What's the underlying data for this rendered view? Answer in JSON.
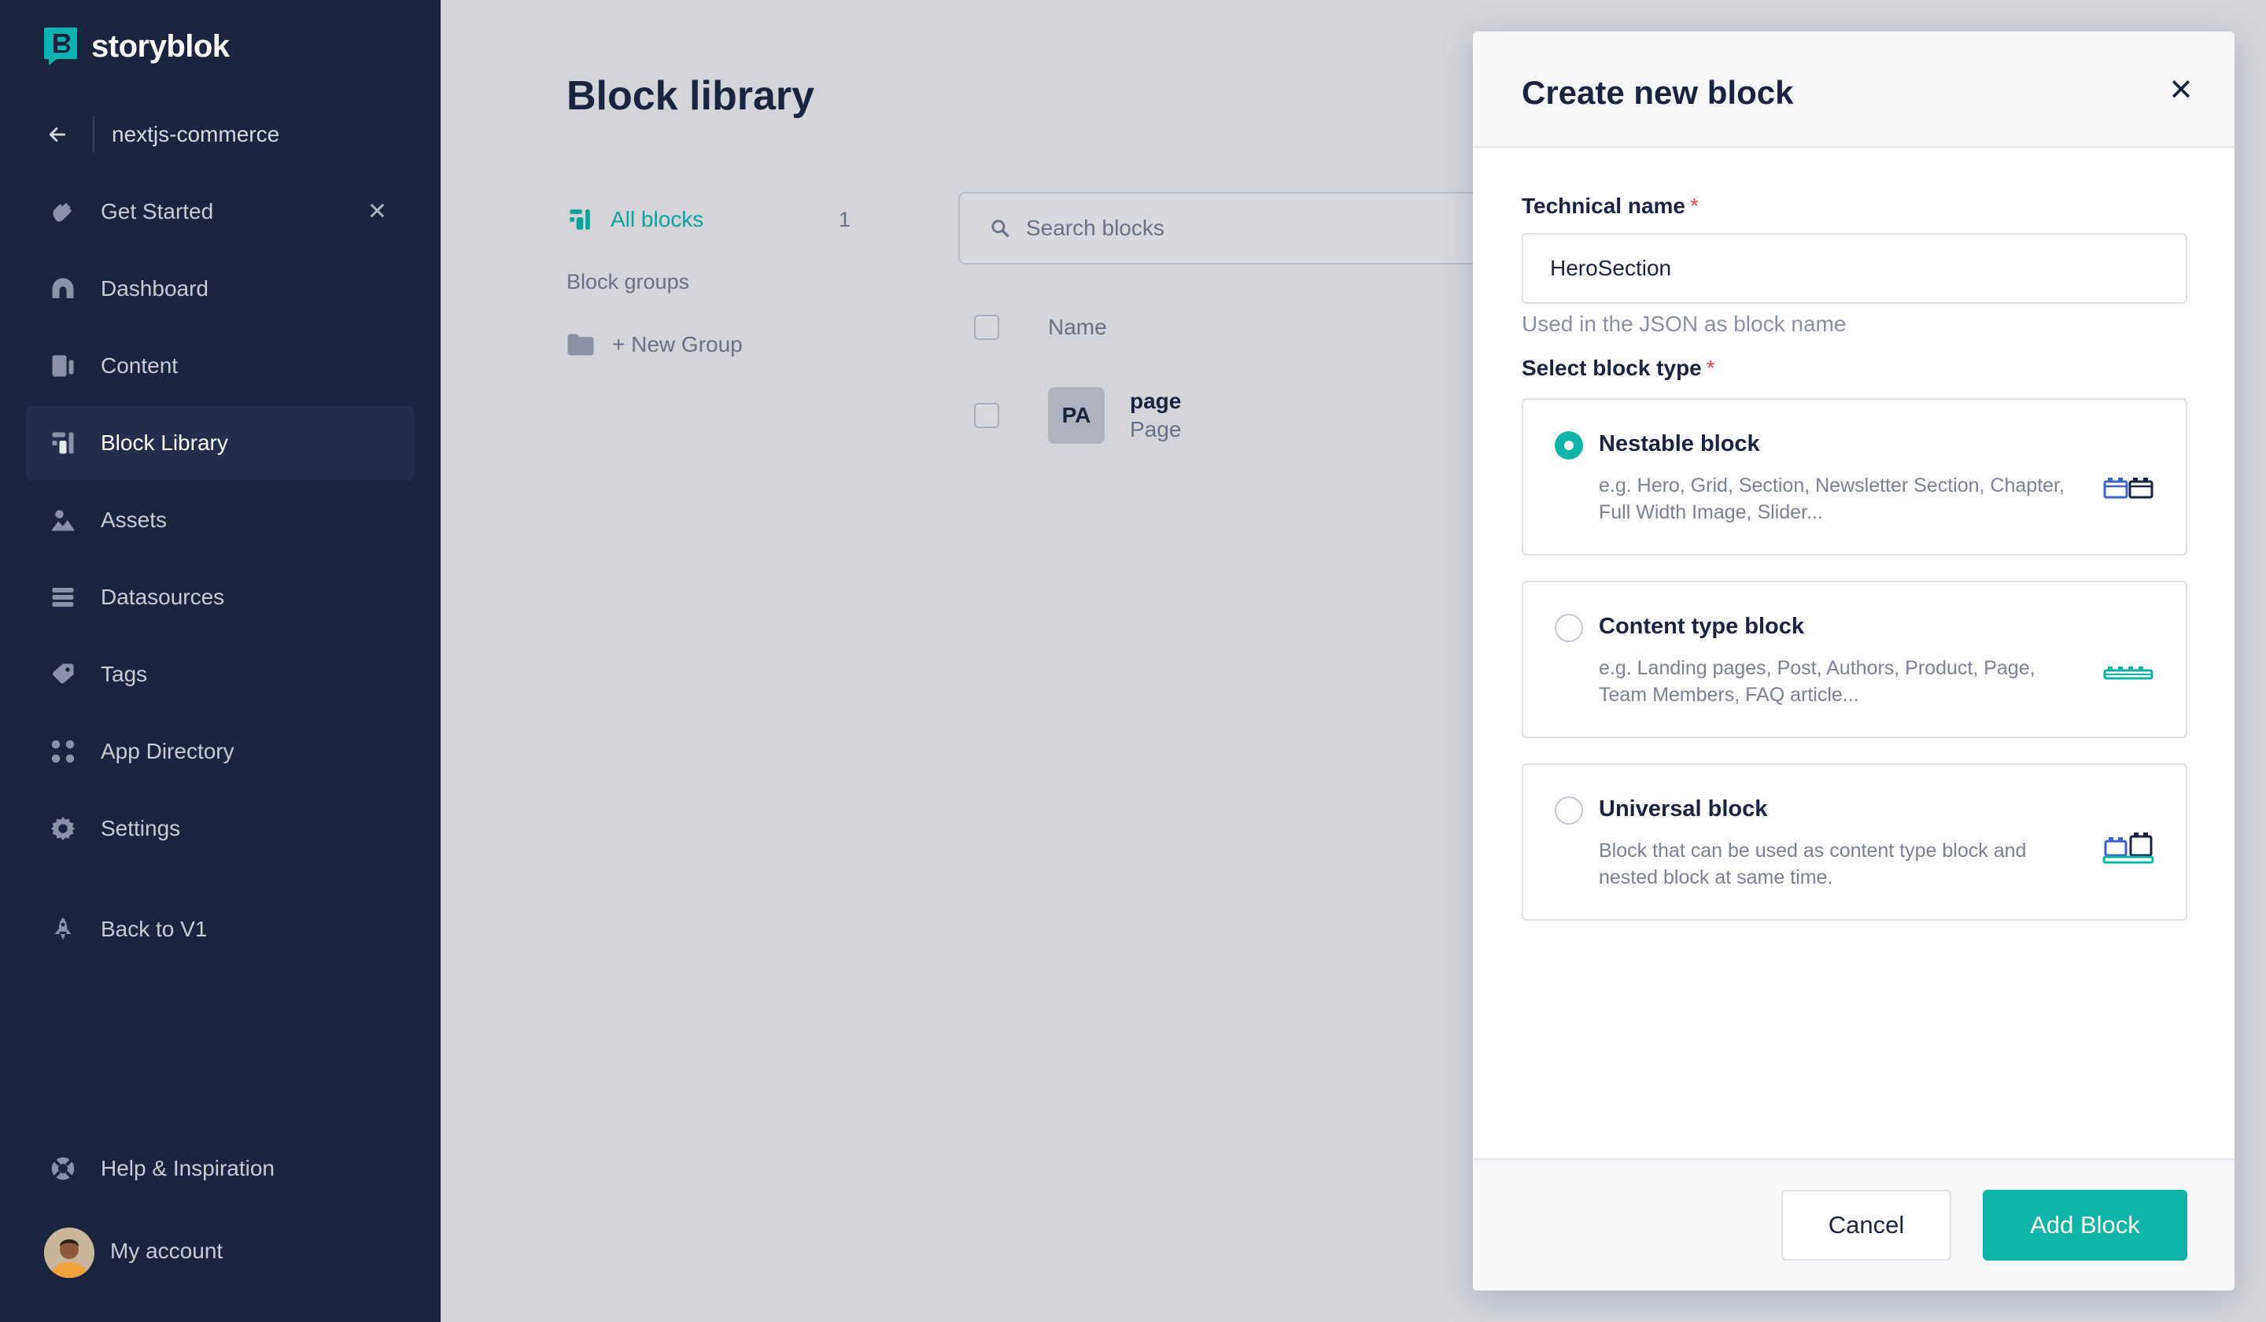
{
  "brand": {
    "name": "storyblok",
    "accent": "#10b3a8",
    "sidebar_bg": "#1b243f"
  },
  "sidebar": {
    "space_name": "nextjs-commerce",
    "items": [
      {
        "label": "Get Started",
        "icon": "wave-hand-icon",
        "closable": true
      },
      {
        "label": "Dashboard",
        "icon": "dashboard-icon"
      },
      {
        "label": "Content",
        "icon": "content-icon"
      },
      {
        "label": "Block Library",
        "icon": "block-library-icon",
        "active": true
      },
      {
        "label": "Assets",
        "icon": "assets-icon"
      },
      {
        "label": "Datasources",
        "icon": "datasources-icon"
      },
      {
        "label": "Tags",
        "icon": "tag-icon"
      },
      {
        "label": "App Directory",
        "icon": "apps-icon"
      },
      {
        "label": "Settings",
        "icon": "gear-icon"
      },
      {
        "label": "Back to V1",
        "icon": "rocket-icon"
      }
    ],
    "help_label": "Help & Inspiration",
    "account_label": "My account"
  },
  "main": {
    "title": "Block library",
    "all_blocks_label": "All blocks",
    "all_blocks_count": "1",
    "groups_heading": "Block groups",
    "new_group_label": "+ New Group",
    "search_placeholder": "Search blocks",
    "table": {
      "column_name": "Name",
      "rows": [
        {
          "initials": "PA",
          "name": "page",
          "type": "Page"
        }
      ]
    }
  },
  "modal": {
    "title": "Create new block",
    "technical_name_label": "Technical name",
    "required_mark": "*",
    "technical_name_value": "HeroSection",
    "technical_name_hint": "Used in the JSON as block name",
    "block_type_label": "Select block type",
    "options": [
      {
        "title": "Nestable block",
        "description": "e.g. Hero, Grid, Section, Newsletter Section, Chapter, Full Width Image, Slider...",
        "selected": true
      },
      {
        "title": "Content type block",
        "description": "e.g. Landing pages, Post, Authors, Product, Page, Team Members, FAQ article...",
        "selected": false
      },
      {
        "title": "Universal block",
        "description": "Block that can be used as content type block and nested block at same time.",
        "selected": false
      }
    ],
    "cancel_label": "Cancel",
    "submit_label": "Add Block"
  }
}
